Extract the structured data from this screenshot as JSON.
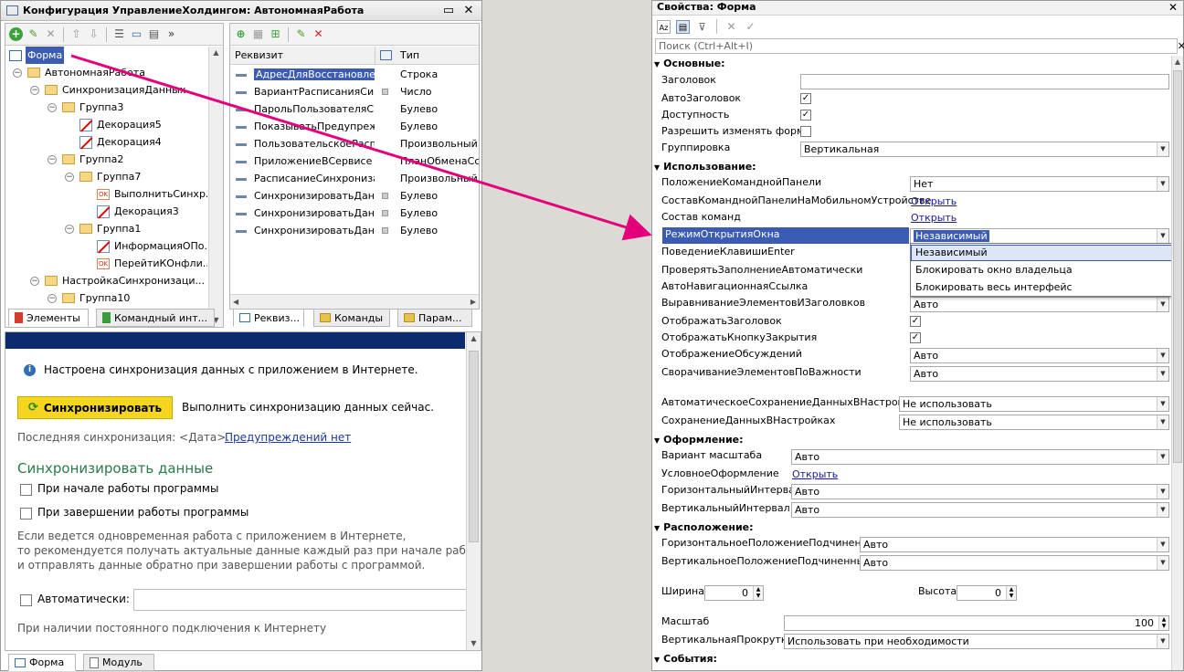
{
  "left_window": {
    "title": "Конфигурация УправлениеХолдингом: АвтономнаяРабота",
    "title_buttons": [
      "▭",
      "✕"
    ],
    "elements_tree": [
      {
        "label": "Форма",
        "indent": 0,
        "kind": "form",
        "toggle": ""
      },
      {
        "label": "АвтономнаяРабота",
        "indent": 0,
        "kind": "folder",
        "toggle": "⊖"
      },
      {
        "label": "СинхронизацияДанных",
        "indent": 1,
        "kind": "folder",
        "toggle": "⊖"
      },
      {
        "label": "Группа3",
        "indent": 2,
        "kind": "folder",
        "toggle": "⊖"
      },
      {
        "label": "Декорация5",
        "indent": 3,
        "kind": "deco",
        "toggle": ""
      },
      {
        "label": "Декорация4",
        "indent": 3,
        "kind": "deco",
        "toggle": ""
      },
      {
        "label": "Группа2",
        "indent": 2,
        "kind": "folder",
        "toggle": "⊖"
      },
      {
        "label": "Группа7",
        "indent": 3,
        "kind": "folder",
        "toggle": "⊖"
      },
      {
        "label": "ВыполнитьСинхр...",
        "indent": 4,
        "kind": "ok",
        "toggle": ""
      },
      {
        "label": "Декорация3",
        "indent": 4,
        "kind": "deco",
        "toggle": ""
      },
      {
        "label": "Группа1",
        "indent": 3,
        "kind": "folder",
        "toggle": "⊖"
      },
      {
        "label": "ИнформацияОПо...",
        "indent": 4,
        "kind": "deco",
        "toggle": ""
      },
      {
        "label": "ПерейтиКОнфли...",
        "indent": 4,
        "kind": "ok",
        "toggle": ""
      },
      {
        "label": "НастройкаСинхронизаци...",
        "indent": 1,
        "kind": "folder",
        "toggle": "⊖"
      },
      {
        "label": "Группа10",
        "indent": 2,
        "kind": "folder",
        "toggle": "⊖"
      }
    ],
    "attr_columns": {
      "name": "Реквизит",
      "type": "Тип"
    },
    "attributes": [
      {
        "name": "АдресДляВосстановле...",
        "type": "Строка",
        "selected": true,
        "marker": false
      },
      {
        "name": "ВариантРасписанияСин...",
        "type": "Число",
        "selected": false,
        "marker": true
      },
      {
        "name": "ПарольПользователяС...",
        "type": "Булево",
        "selected": false,
        "marker": false
      },
      {
        "name": "ПоказыватьПредупреж...",
        "type": "Булево",
        "selected": false,
        "marker": false
      },
      {
        "name": "ПользовательскоеРасп...",
        "type": "Произвольный",
        "selected": false,
        "marker": false
      },
      {
        "name": "ПриложениеВСервисе",
        "type": "ПланОбменаСсы",
        "selected": false,
        "marker": false
      },
      {
        "name": "РасписаниеСинхрониза...",
        "type": "Произвольный",
        "selected": false,
        "marker": false
      },
      {
        "name": "СинхронизироватьДанн...",
        "type": "Булево",
        "selected": false,
        "marker": true
      },
      {
        "name": "СинхронизироватьДанн...",
        "type": "Булево",
        "selected": false,
        "marker": true
      },
      {
        "name": "СинхронизироватьДанн...",
        "type": "Булево",
        "selected": false,
        "marker": true
      }
    ],
    "tabs_left": [
      "Элементы",
      "Командный инт..."
    ],
    "tabs_right": [
      "Реквиз...",
      "Команды",
      "Парам..."
    ],
    "preview": {
      "info_text": "Настроена синхронизация данных с приложением в Интернете.",
      "sync_button": "Синхронизировать",
      "sync_hint": "Выполнить синхронизацию данных сейчас.",
      "last_sync": "Последняя синхронизация: <Дата>.",
      "warnings_link": "Предупреждений нет",
      "section_title": "Синхронизировать данные",
      "check_start": "При начале работы программы",
      "check_end": "При завершении работы программы",
      "note_line1": "Если ведется одновременная работа с приложением в Интернете,",
      "note_line2": "то рекомендуется получать актуальные данные каждый раз при начале работы пр",
      "note_line3": "и отправлять данные обратно при завершении работы с программой.",
      "auto_label": "Автоматически:",
      "permanent_text": "При наличии постоянного подключения к Интернету"
    },
    "bottom_tabs": [
      "Форма",
      "Модуль"
    ]
  },
  "properties": {
    "title": "Свойства: Форма",
    "search_placeholder": "Поиск (Ctrl+Alt+I)",
    "sections": {
      "main": "Основные:",
      "usage": "Использование:",
      "design": "Оформление:",
      "layout": "Расположение:",
      "events": "События:"
    },
    "rows": {
      "zagolovok": "Заголовок",
      "autozag": "АвтоЗаголовок",
      "dostupnost": "Доступность",
      "razreshit": "Разрешить изменять форму",
      "gruppirovka": "Группировка",
      "gruppirovka_val": "Вертикальная",
      "polozh_kp": "ПоложениеКоманднойПанели",
      "polozh_kp_val": "Нет",
      "sostav_mob": "СоставКоманднойПанелиНаМобильномУстройстве",
      "sostav_mob_val": "Открыть",
      "sostav_kom": "Состав команд",
      "sostav_kom_val": "Открыть",
      "rezhim": "РежимОткрытияОкна",
      "rezhim_val": "Независимый",
      "povedenie": "ПоведениеКлавишиEnter",
      "proverka": "ПроверятьЗаполнениеАвтоматически",
      "autonav": "АвтоНавигационнаяСсылка",
      "vyravn": "ВыравниваниеЭлементовИЗаголовков",
      "vyravn_val": "Авто",
      "otobr_zag": "ОтображатьЗаголовок",
      "otobr_knopku": "ОтображатьКнопкуЗакрытия",
      "otobr_obsuzh": "ОтображениеОбсуждений",
      "otobr_obsuzh_val": "Авто",
      "svorach": "СворачиваниеЭлементовПоВажности",
      "svorach_val": "Авто",
      "autosave": "АвтоматическоеСохранениеДанныхВНастройках",
      "autosave_val": "Не использовать",
      "sohranenie": "СохранениеДанныхВНастройках",
      "sohranenie_val": "Не использовать",
      "variant_masht": "Вариант масштаба",
      "variant_masht_val": "Авто",
      "uslovnoe": "УсловноеОформление",
      "uslovnoe_val": "Открыть",
      "gor_int": "ГоризонтальныйИнтервал",
      "gor_int_val": "Авто",
      "vert_int": "ВертикальныйИнтервал",
      "vert_int_val": "Авто",
      "gor_polozh": "ГоризонтальноеПоложениеПодчиненных",
      "gor_polozh_val": "Авто",
      "vert_polozh": "ВертикальноеПоложениеПодчиненных",
      "vert_polozh_val": "Авто",
      "shirina": "Ширина",
      "shirina_val": "0",
      "vysota": "Высота",
      "vysota_val": "0",
      "masshtab": "Масштаб",
      "masshtab_val": "100",
      "vert_prokr": "ВертикальнаяПрокрутка",
      "vert_prokr_val": "Использовать при необходимости"
    },
    "dropdown_options": [
      "Независимый",
      "Блокировать окно владельца",
      "Блокировать весь интерфейс"
    ],
    "checks": {
      "autozag": true,
      "dostupnost": true,
      "razreshit": false,
      "otobr_zag": true,
      "otobr_knopku": true
    }
  },
  "colors": {
    "arrow": "#e4007c",
    "selection": "#3c5cb4",
    "accent_button": "#f4d61e"
  }
}
